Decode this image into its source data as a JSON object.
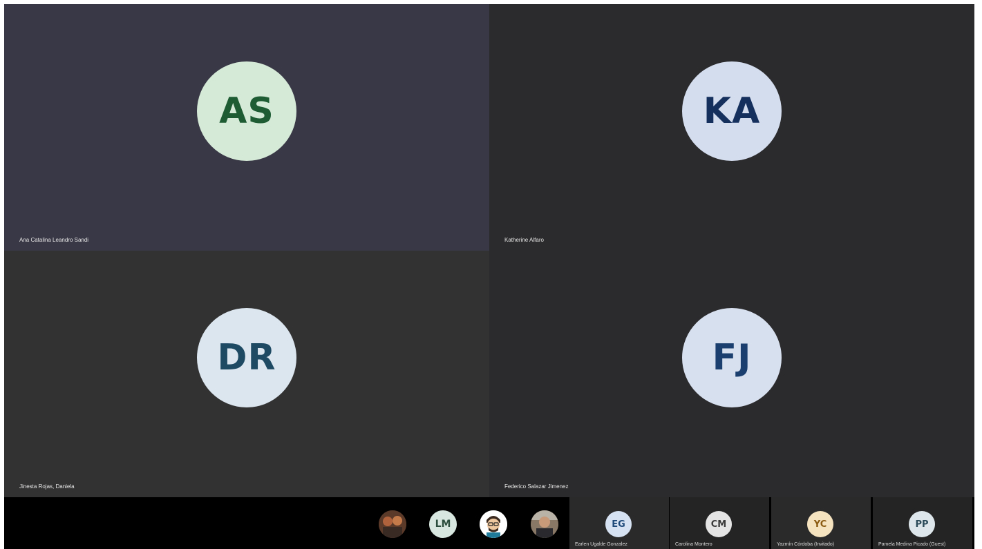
{
  "tiles": [
    {
      "initials": "AS",
      "name": "Ana Catalina Leandro Sandi",
      "avatar_bg": "#d6ead8",
      "avatar_fg": "#1e5c34"
    },
    {
      "initials": "KA",
      "name": "Katherine Alfaro",
      "avatar_bg": "#d3ddee",
      "avatar_fg": "#16305e"
    },
    {
      "initials": "DR",
      "name": "Jinesta Rojas, Daniela",
      "avatar_bg": "#dbe6ef",
      "avatar_fg": "#1f4a64"
    },
    {
      "initials": "FJ",
      "name": "Federico Salazar Jimenez",
      "avatar_bg": "#d7e0ef",
      "avatar_fg": "#1b3f6e"
    }
  ],
  "strip": {
    "photo_participants": [
      {
        "icon": "participant-photo-icon"
      },
      {
        "initials": "LM"
      },
      {
        "icon": "participant-cartoon-avatar-icon"
      },
      {
        "icon": "participant-photo-icon"
      }
    ],
    "named_participants": [
      {
        "initials": "EG",
        "name": "Earlen Ugalde Gonzalez",
        "avatar_bg": "#d6e2f2",
        "avatar_fg": "#1e4a7a"
      },
      {
        "initials": "CM",
        "name": "Carolina Montero",
        "avatar_bg": "#e4e4e4",
        "avatar_fg": "#3a3a3a"
      },
      {
        "initials": "YC",
        "name": "Yazmín Córdoba (Invitado)",
        "avatar_bg": "#f5e2bf",
        "avatar_fg": "#8a5a10"
      },
      {
        "initials": "PP",
        "name": "Pamela Medina Picado (Guest)",
        "avatar_bg": "#dde6ea",
        "avatar_fg": "#2a4a5a"
      }
    ]
  },
  "colors": {
    "active_tile": "#393846",
    "tile": "#2d2c2e",
    "strip": "#000000"
  }
}
